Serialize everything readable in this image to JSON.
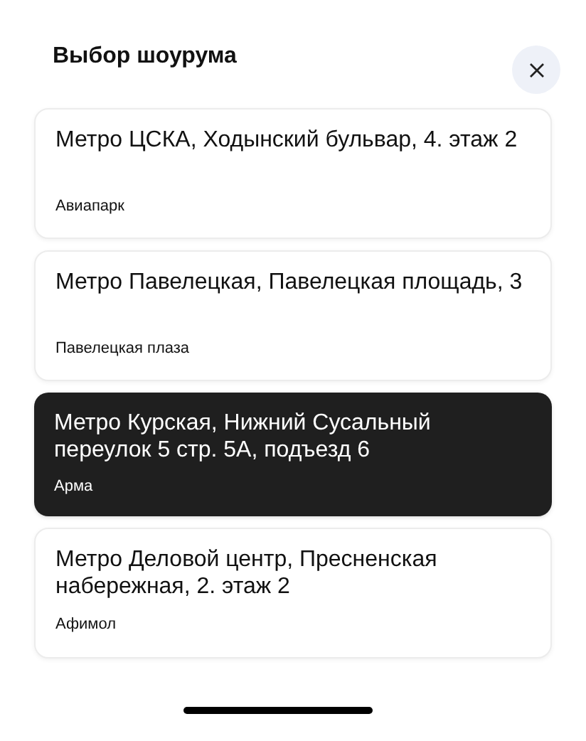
{
  "title": "Выбор шоурума",
  "showrooms": [
    {
      "address": "Метро ЦСКА, Ходынский бульвар, 4. этаж 2",
      "name": "Авиапарк",
      "selected": false
    },
    {
      "address": "Метро Павелецкая, Павелецкая площадь, 3",
      "name": "Павелецкая плаза",
      "selected": false
    },
    {
      "address": "Метро Курская, Нижний Сусальный переулок 5 стр. 5А, подъезд 6",
      "name": "Арма",
      "selected": true
    },
    {
      "address": "Метро Деловой центр, Пресненская набережная, 2. этаж 2",
      "name": "Афимол",
      "selected": false
    }
  ]
}
